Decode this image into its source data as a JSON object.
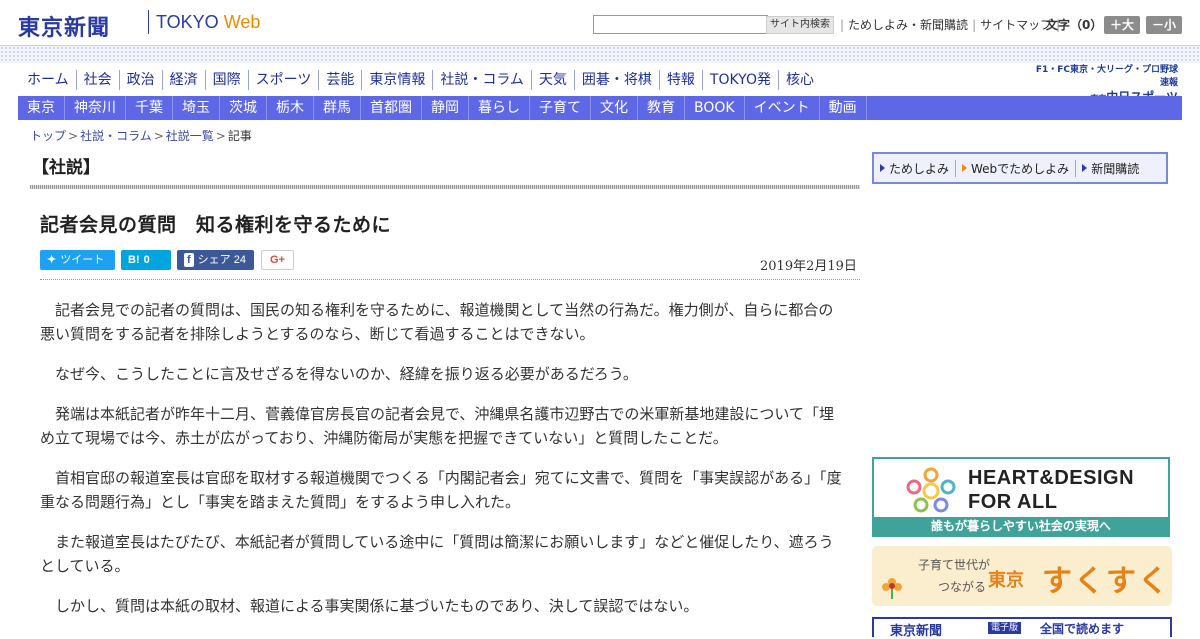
{
  "header": {
    "logo_text": "東京新聞",
    "logo_tokyo": "TOKYO",
    "logo_web": "Web",
    "search_placeholder": "",
    "search_button": "サイト内検索",
    "util_links": [
      "ためしよみ・新聞購読",
      "サイトマップ"
    ],
    "font_size_label": "文字（0）",
    "font_larger": "＋大",
    "font_smaller": "－小"
  },
  "nav_primary": [
    "ホーム",
    "社会",
    "政治",
    "経済",
    "国際",
    "スポーツ",
    "芸能",
    "東京情報",
    "社説・コラム",
    "天気",
    "囲碁・将棋",
    "特報",
    "TOKYO発",
    "核心"
  ],
  "chunichi": {
    "line1": "F1・FC東京・大リーグ・プロ野球速報",
    "line2_small": "東京",
    "line2": "中日スポーツ"
  },
  "nav_secondary": [
    "東京",
    "神奈川",
    "千葉",
    "埼玉",
    "茨城",
    "栃木",
    "群馬",
    "首都圏",
    "静岡",
    "暮らし",
    "子育て",
    "文化",
    "教育",
    "BOOK",
    "イベント",
    "動画"
  ],
  "breadcrumb": {
    "items": [
      "トップ",
      "社説・コラム",
      "社説一覧"
    ],
    "current": "記事"
  },
  "section_label": "【社説】",
  "article": {
    "headline": "記者会見の質問　知る権利を守るために",
    "date": "2019年2月19日",
    "share": {
      "tweet": "ツイート",
      "hatena_icon": "B!",
      "hatena_count": "0",
      "fb_label": "シェア",
      "fb_count": "24",
      "gplus": "G+"
    },
    "paragraphs": [
      "記者会見での記者の質問は、国民の知る権利を守るために、報道機関として当然の行為だ。権力側が、自らに都合の悪い質問をする記者を排除しようとするのなら、断じて看過することはできない。",
      "なぜ今、こうしたことに言及せざるを得ないのか、経緯を振り返る必要があるだろう。",
      "発端は本紙記者が昨年十二月、菅義偉官房長官の記者会見で、沖縄県名護市辺野古での米軍新基地建設について「埋め立て現場では今、赤土が広がっており、沖縄防衛局が実態を把握できていない」と質問したことだ。",
      "首相官邸の報道室長は官邸を取材する報道機関でつくる「内閣記者会」宛てに文書で、質問を「事実誤認がある」「度重なる問題行為」とし「事実を踏まえた質問」をするよう申し入れた。",
      "また報道室長はたびたび、本紙記者が質問している途中に「質問は簡潔にお願いします」などと催促したり、遮ろうとしている。",
      "しかし、質問は本紙の取材、報道による事実関係に基づいたものであり、決して誤認ではない。"
    ]
  },
  "sidebar": {
    "subscribe_links": [
      "ためしよみ",
      "Webでためしよみ",
      "新聞購読"
    ],
    "heart_design": {
      "line1": "HEART&DESIGN",
      "line2": "FOR ALL",
      "caption": "誰もが暮らしやすい社会の実現へ"
    },
    "sukusuku": {
      "line1": "子育て世代が",
      "line2": "つながる",
      "tokyo": "東京",
      "brand": "すくすく"
    },
    "bottom_banner": {
      "logo": "東京新聞",
      "badge": "電子版",
      "text": "全国で読めます"
    }
  }
}
